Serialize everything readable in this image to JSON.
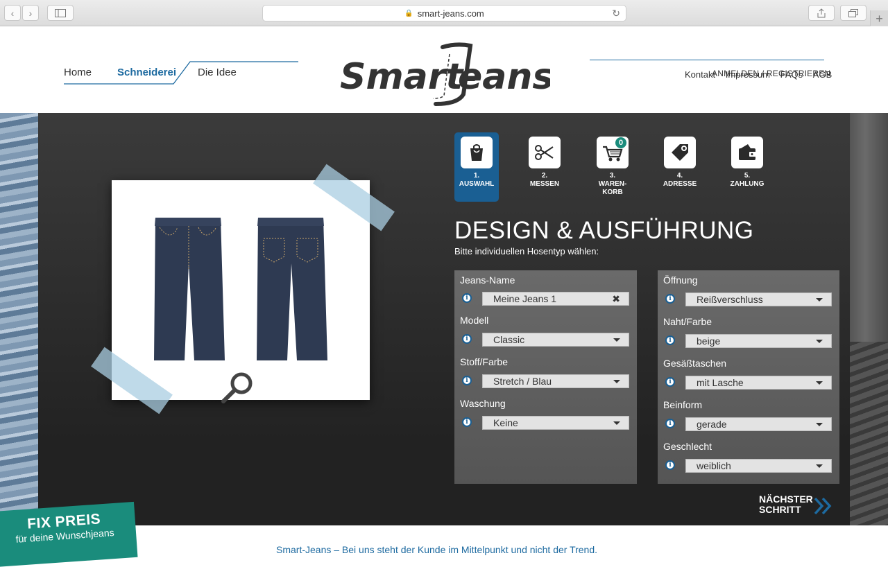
{
  "browser": {
    "url": "smart-jeans.com"
  },
  "nav": {
    "home": "Home",
    "schneiderei": "Schneiderei",
    "idee": "Die Idee"
  },
  "brand": "Smart-Jeans",
  "toplinks": {
    "kontakt": "Kontakt",
    "impressum": "Impressum",
    "faqs": "FAQs",
    "agb": "AGB",
    "login": "ANMELDEN / REGISTRIEREN"
  },
  "steps": [
    {
      "num": "1.",
      "label": "AUSWAHL",
      "icon": "shopping-bag-icon",
      "active": true
    },
    {
      "num": "2.",
      "label": "MESSEN",
      "icon": "scissors-icon"
    },
    {
      "num": "3.",
      "label": "WAREN-\nKORB",
      "icon": "cart-icon",
      "badge": "0"
    },
    {
      "num": "4.",
      "label": "ADRESSE",
      "icon": "tag-icon"
    },
    {
      "num": "5.",
      "label": "ZAHLUNG",
      "icon": "wallet-icon"
    }
  ],
  "heading": "DESIGN & AUSFÜHRUNG",
  "subheading": "Bitte individuellen Hosentyp wählen:",
  "left_fields": [
    {
      "label": "Jeans-Name",
      "value": "Meine Jeans 1",
      "type": "text"
    },
    {
      "label": "Modell",
      "value": "Classic",
      "type": "select"
    },
    {
      "label": "Stoff/Farbe",
      "value": "Stretch / Blau",
      "type": "select"
    },
    {
      "label": "Waschung",
      "value": "Keine",
      "type": "select"
    }
  ],
  "right_fields": [
    {
      "label": "Öffnung",
      "value": "Reißverschluss"
    },
    {
      "label": "Naht/Farbe",
      "value": "beige"
    },
    {
      "label": "Gesäßtaschen",
      "value": "mit Lasche"
    },
    {
      "label": "Beinform",
      "value": "gerade"
    },
    {
      "label": "Geschlecht",
      "value": "weiblich"
    }
  ],
  "next_step": {
    "line1": "NÄCHSTER",
    "line2": "SCHRITT"
  },
  "promo": {
    "line1": "FIX PREIS",
    "line2": "für deine Wunschjeans"
  },
  "footer_text": "Smart-Jeans – Bei uns steht der Kunde im Mittelpunkt und nicht der Trend.",
  "colors": {
    "accent": "#1a5f93",
    "teal": "#1a8c7c",
    "link": "#1d6aa0"
  }
}
